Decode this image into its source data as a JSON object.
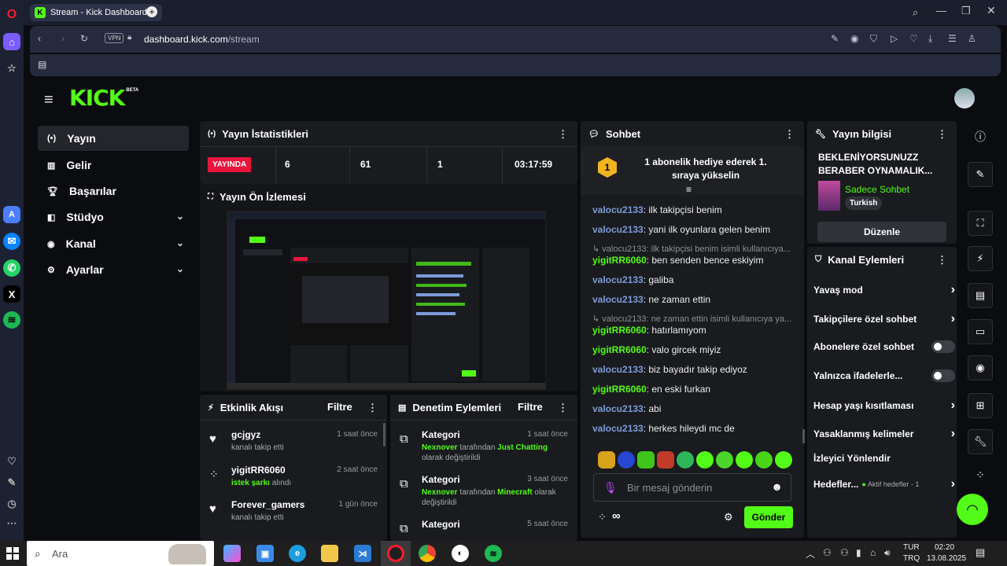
{
  "browser": {
    "tab_title": "Stream - Kick Dashboard",
    "url_domain": "dashboard.kick.com",
    "url_prefix": "",
    "url_path": "/stream",
    "vpn_label": "VPN",
    "opera_letter": "O",
    "x_letter": "X"
  },
  "brand": {
    "logo": "KICK",
    "beta": "BETA"
  },
  "nav": [
    {
      "label": "Yayın",
      "icon": "broadcast-icon"
    },
    {
      "label": "Gelir",
      "icon": "chart-icon"
    },
    {
      "label": "Başarılar",
      "icon": "trophy-icon"
    },
    {
      "label": "Stüdyo",
      "icon": "studio-icon"
    },
    {
      "label": "Kanal",
      "icon": "eye-icon"
    },
    {
      "label": "Ayarlar",
      "icon": "gear-icon"
    }
  ],
  "stats": {
    "title": "Yayın İstatistikleri",
    "live_badge": "YAYINDA",
    "values": [
      "6",
      "61",
      "1",
      "03:17:59"
    ]
  },
  "preview": {
    "title": "Yayın Ön İzlemesi"
  },
  "activity": {
    "title": "Etkinlik Akışı",
    "filter": "Filtre",
    "items": [
      {
        "name": "gcjgyz",
        "time": "1 saat önce",
        "desc": "kanalı takip etti",
        "highlight": ""
      },
      {
        "name": "yigitRR6060",
        "time": "2 saat önce",
        "desc": " alındı",
        "highlight": "istek şarkı"
      },
      {
        "name": "Forever_gamers",
        "time": "1 gün önce",
        "desc": "kanalı takip etti",
        "highlight": ""
      }
    ]
  },
  "moderation": {
    "title": "Denetim Eylemleri",
    "filter": "Filtre",
    "items": [
      {
        "title": "Kategori",
        "time": "1 saat önce",
        "user": "Nexnover",
        "mid": " tarafından ",
        "cat": "Just Chatting",
        "end": "olarak değiştirildi"
      },
      {
        "title": "Kategori",
        "time": "3 saat önce",
        "user": "Nexnover",
        "mid": " tarafından ",
        "cat": "Minecraft",
        "end": " olarak değiştirildi"
      },
      {
        "title": "Kategori",
        "time": "5 saat önce"
      }
    ]
  },
  "chat": {
    "title": "Sohbet",
    "pinned": "1 abonelik hediye ederek 1. sıraya yükselin",
    "pinned_rank": "1",
    "messages": [
      {
        "user": "valocu2133",
        "text": ": ilk takipçisi benim",
        "color": "blue"
      },
      {
        "user": "valocu2133",
        "text": ": yani ilk oyunlara gelen benim",
        "color": "blue"
      },
      {
        "reply": "↳ valocu2133: ilk takipçisi benim isimli kullanıcıya...",
        "user": "yigitRR6060",
        "text": ": ben senden bence eskiyim",
        "color": "green"
      },
      {
        "user": "valocu2133",
        "text": ": galiba",
        "color": "blue"
      },
      {
        "user": "valocu2133",
        "text": ": ne zaman ettin",
        "color": "blue"
      },
      {
        "reply": "↳ valocu2133: ne zaman ettin isimli kullanıcıya ya...",
        "user": "yigitRR6060",
        "text": ": hatırlamıyom",
        "color": "green"
      },
      {
        "user": "yigitRR6060",
        "text": ": valo gircek miyiz",
        "color": "green"
      },
      {
        "user": "valocu2133",
        "text": ": biz bayadır takip ediyoz",
        "color": "blue"
      },
      {
        "user": "yigitRR6060",
        "text": ": en eski furkan",
        "color": "green"
      },
      {
        "user": "valocu2133",
        "text": ": abi",
        "color": "blue"
      },
      {
        "user": "valocu2133",
        "text": ": herkes hileydi mc de",
        "color": "blue"
      }
    ],
    "placeholder": "Bir mesaj gönderin",
    "send": "Gönder",
    "infinity": "∞"
  },
  "stream_info": {
    "title": "Yayın bilgisi",
    "stream_title": "BEKLENİYORSUNUZZ BERABER OYNAMALIK...",
    "category": "Sadece Sohbet",
    "language": "Turkish",
    "edit": "Düzenle"
  },
  "channel_actions": {
    "title": "Kanal Eylemleri",
    "items": [
      {
        "label": "Yavaş mod",
        "type": "chevron"
      },
      {
        "label": "Takipçilere özel sohbet",
        "type": "chevron"
      },
      {
        "label": "Abonelere özel sohbet",
        "type": "toggle"
      },
      {
        "label": "Yalnızca ifadelerle...",
        "type": "toggle"
      },
      {
        "label": "Hesap yaşı kısıtlaması",
        "type": "chevron"
      },
      {
        "label": "Yasaklanmış kelimeler",
        "type": "chevron"
      },
      {
        "label": "İzleyici Yönlendir",
        "type": "none"
      },
      {
        "label": "Hedefler...",
        "type": "chevron",
        "extra": "Aktif hedefler - 1"
      }
    ]
  },
  "taskbar": {
    "search": "Ara",
    "lang1": "TUR",
    "lang2": "TRQ",
    "time": "02:20",
    "date": "13.08.2025"
  },
  "colors": {
    "accent": "#53fc18",
    "live": "#e8143c",
    "panel": "#191b1f",
    "bg": "#0b0c10"
  }
}
